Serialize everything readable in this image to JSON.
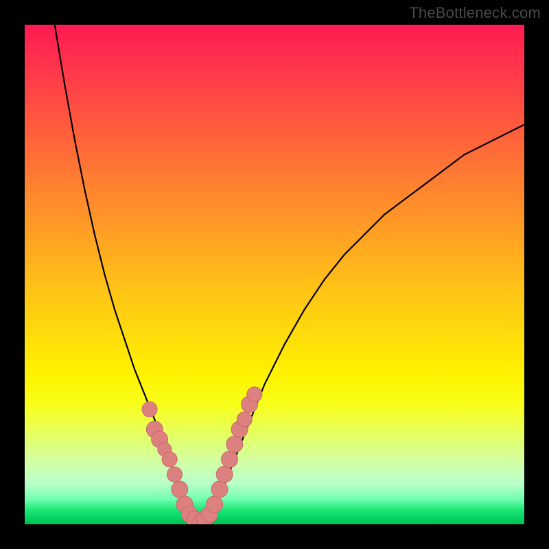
{
  "watermark": "TheBottleneck.com",
  "colors": {
    "frame": "#000000",
    "curve": "#000000",
    "marker_fill": "#dd8080",
    "marker_stroke": "#c86868",
    "gradient_top": "#ff1a52",
    "gradient_bottom": "#00c050"
  },
  "chart_data": {
    "type": "line",
    "title": "",
    "xlabel": "",
    "ylabel": "",
    "xlim": [
      0,
      100
    ],
    "ylim": [
      0,
      100
    ],
    "grid": false,
    "x": [
      6,
      8,
      10,
      12,
      14,
      16,
      18,
      20,
      22,
      24,
      26,
      27,
      28,
      29,
      30,
      31,
      32,
      33,
      34,
      35,
      36,
      38,
      40,
      42,
      44,
      46,
      48,
      52,
      56,
      60,
      64,
      68,
      72,
      76,
      80,
      84,
      88,
      92,
      96,
      100
    ],
    "y": [
      100,
      88,
      77,
      67,
      58,
      50,
      43,
      37,
      31,
      26,
      21,
      18,
      16,
      13,
      10,
      7,
      4,
      2,
      0.5,
      0,
      0.5,
      3,
      8,
      13,
      18,
      23,
      28,
      36,
      43,
      49,
      54,
      58,
      62,
      65,
      68,
      71,
      74,
      76,
      78,
      80
    ],
    "series": [
      {
        "name": "bottleneck-curve",
        "x": [
          6,
          8,
          10,
          12,
          14,
          16,
          18,
          20,
          22,
          24,
          26,
          27,
          28,
          29,
          30,
          31,
          32,
          33,
          34,
          35,
          36,
          38,
          40,
          42,
          44,
          46,
          48,
          52,
          56,
          60,
          64,
          68,
          72,
          76,
          80,
          84,
          88,
          92,
          96,
          100
        ],
        "y": [
          100,
          88,
          77,
          67,
          58,
          50,
          43,
          37,
          31,
          26,
          21,
          18,
          16,
          13,
          10,
          7,
          4,
          2,
          0.5,
          0,
          0.5,
          3,
          8,
          13,
          18,
          23,
          28,
          36,
          43,
          49,
          54,
          58,
          62,
          65,
          68,
          71,
          74,
          76,
          78,
          80
        ]
      }
    ],
    "markers": {
      "name": "highlighted-points",
      "x": [
        25,
        26,
        27,
        28,
        29,
        30,
        31,
        32,
        33,
        34,
        35,
        36,
        37,
        38,
        39,
        40,
        41,
        42,
        43,
        44,
        45,
        46
      ],
      "y": [
        23,
        19,
        17,
        15,
        13,
        10,
        7,
        4,
        2,
        1,
        0,
        1,
        2,
        4,
        7,
        10,
        13,
        16,
        19,
        21,
        24,
        26
      ],
      "r": [
        11,
        12,
        12,
        10,
        11,
        11,
        12,
        12,
        12,
        12,
        12,
        12,
        12,
        12,
        12,
        12,
        12,
        12,
        12,
        11,
        12,
        11
      ]
    }
  }
}
